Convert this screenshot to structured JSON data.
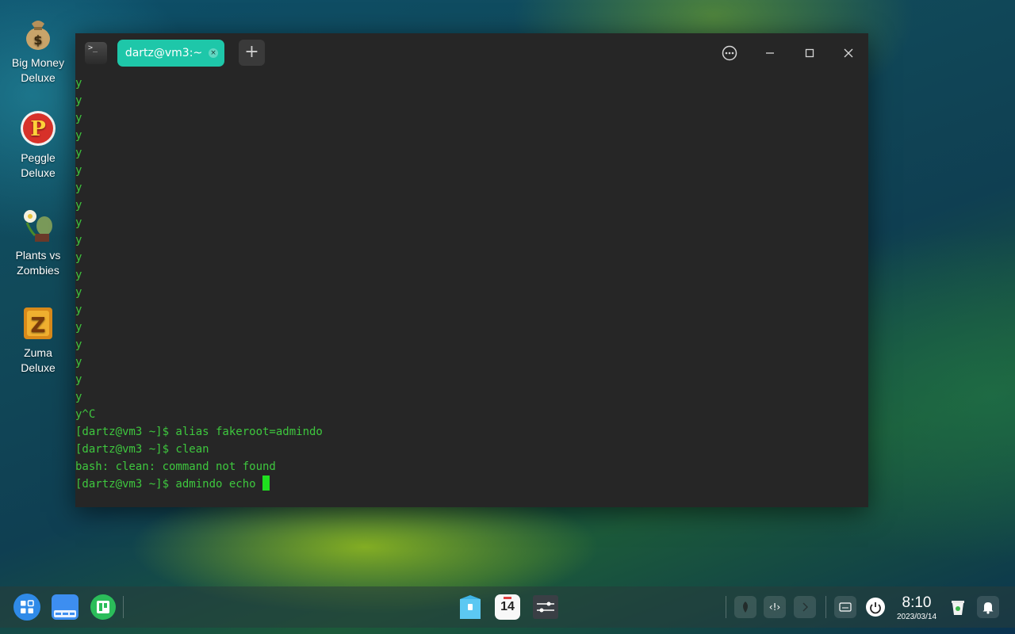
{
  "desktop": {
    "icons": [
      {
        "label_line1": "Big Money",
        "label_line2": "Deluxe",
        "icon": "money-bag-icon"
      },
      {
        "label_line1": "Peggle",
        "label_line2": "Deluxe",
        "icon": "peggle-icon"
      },
      {
        "label_line1": "Plants vs",
        "label_line2": "Zombies",
        "icon": "plants-vs-zombies-icon"
      },
      {
        "label_line1": "Zuma",
        "label_line2": "Deluxe",
        "icon": "zuma-icon"
      }
    ]
  },
  "terminal": {
    "app_icon_text": ">_",
    "tab_title": "dartz@vm3:~",
    "tab_close": "×",
    "add_tab": "+",
    "menu_icon": "⋯",
    "minimize": "—",
    "maximize": "☐",
    "close": "✕",
    "lines": [
      "y",
      "y",
      "y",
      "y",
      "y",
      "y",
      "y",
      "y",
      "y",
      "y",
      "y",
      "y",
      "y",
      "y",
      "y",
      "y",
      "y",
      "y",
      "y",
      "y^C",
      "[dartz@vm3 ~]$ alias fakeroot=admindo",
      "[dartz@vm3 ~]$ clean",
      "bash: clean: command not found",
      "[dartz@vm3 ~]$ admindo echo "
    ],
    "text_color": "#3ec73e",
    "background": "#262626"
  },
  "taskbar": {
    "calendar_day": "14",
    "clock_time": "8:10",
    "clock_date": "2023/03/14",
    "tray_code_label": "‹!›"
  },
  "colors": {
    "accent_tab": "#1ec7a9"
  }
}
